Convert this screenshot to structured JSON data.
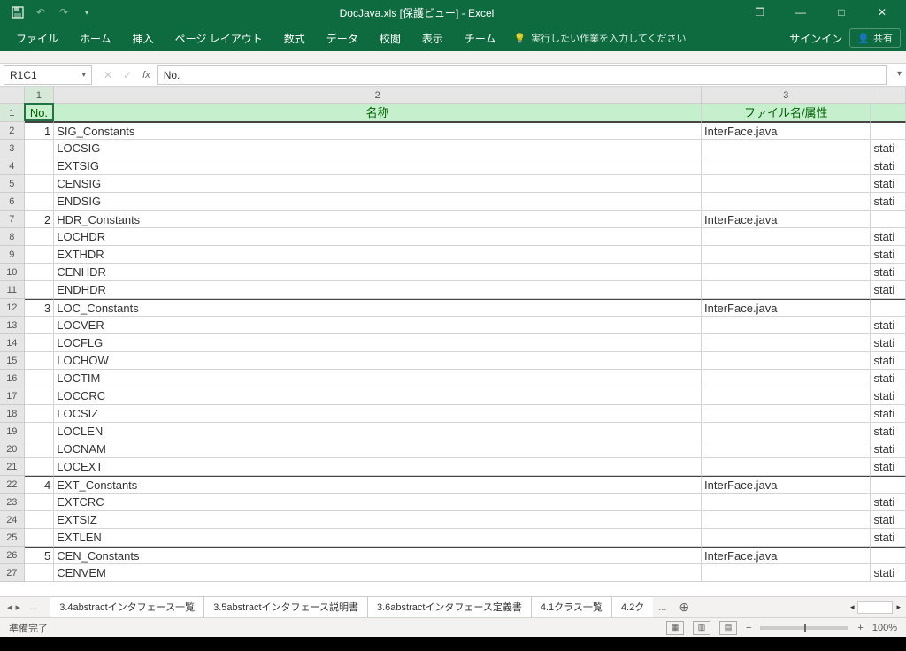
{
  "title": "DocJava.xls  [保護ビュー] - Excel",
  "qat": {
    "undo": "↶",
    "redo": "↷"
  },
  "win": {
    "restore": "❐",
    "min": "—",
    "max": "□",
    "close": "✕"
  },
  "ribbon": {
    "tabs": [
      "ファイル",
      "ホーム",
      "挿入",
      "ページ レイアウト",
      "数式",
      "データ",
      "校閲",
      "表示",
      "チーム"
    ],
    "tellme": "実行したい作業を入力してください",
    "signin": "サインイン",
    "share": "共有"
  },
  "namebox": "R1C1",
  "formula": "No.",
  "cols": [
    "1",
    "2",
    "3",
    ""
  ],
  "headers": {
    "c1": "No.",
    "c2": "名称",
    "c3": "ファイル名/属性",
    "c4": ""
  },
  "rows": [
    {
      "n": "1",
      "name": "SIG_Constants",
      "file": "InterFace.java",
      "t": "",
      "g": true
    },
    {
      "n": "",
      "name": "LOCSIG",
      "file": "",
      "t": "stati"
    },
    {
      "n": "",
      "name": "EXTSIG",
      "file": "",
      "t": "stati"
    },
    {
      "n": "",
      "name": "CENSIG",
      "file": "",
      "t": "stati"
    },
    {
      "n": "",
      "name": "ENDSIG",
      "file": "",
      "t": "stati"
    },
    {
      "n": "2",
      "name": "HDR_Constants",
      "file": "InterFace.java",
      "t": "",
      "g": true
    },
    {
      "n": "",
      "name": "LOCHDR",
      "file": "",
      "t": "stati"
    },
    {
      "n": "",
      "name": "EXTHDR",
      "file": "",
      "t": "stati"
    },
    {
      "n": "",
      "name": "CENHDR",
      "file": "",
      "t": "stati"
    },
    {
      "n": "",
      "name": "ENDHDR",
      "file": "",
      "t": "stati"
    },
    {
      "n": "3",
      "name": "LOC_Constants",
      "file": "InterFace.java",
      "t": "",
      "g": true
    },
    {
      "n": "",
      "name": "LOCVER",
      "file": "",
      "t": "stati"
    },
    {
      "n": "",
      "name": "LOCFLG",
      "file": "",
      "t": "stati"
    },
    {
      "n": "",
      "name": "LOCHOW",
      "file": "",
      "t": "stati"
    },
    {
      "n": "",
      "name": "LOCTIM",
      "file": "",
      "t": "stati"
    },
    {
      "n": "",
      "name": "LOCCRC",
      "file": "",
      "t": "stati"
    },
    {
      "n": "",
      "name": "LOCSIZ",
      "file": "",
      "t": "stati"
    },
    {
      "n": "",
      "name": "LOCLEN",
      "file": "",
      "t": "stati"
    },
    {
      "n": "",
      "name": "LOCNAM",
      "file": "",
      "t": "stati"
    },
    {
      "n": "",
      "name": "LOCEXT",
      "file": "",
      "t": "stati"
    },
    {
      "n": "4",
      "name": "EXT_Constants",
      "file": "InterFace.java",
      "t": "",
      "g": true
    },
    {
      "n": "",
      "name": "EXTCRC",
      "file": "",
      "t": "stati"
    },
    {
      "n": "",
      "name": "EXTSIZ",
      "file": "",
      "t": "stati"
    },
    {
      "n": "",
      "name": "EXTLEN",
      "file": "",
      "t": "stati"
    },
    {
      "n": "5",
      "name": "CEN_Constants",
      "file": "InterFace.java",
      "t": "",
      "g": true
    },
    {
      "n": "",
      "name": "CENVEM",
      "file": "",
      "t": "stati"
    }
  ],
  "sheets": {
    "items": [
      "3.4abstractインタフェース一覧",
      "3.5abstractインタフェース説明書",
      "3.6abstractインタフェース定義書",
      "4.1クラス一覧",
      "4.2ク"
    ],
    "active": 2
  },
  "status": {
    "ready": "準備完了",
    "zoom": "100%"
  }
}
